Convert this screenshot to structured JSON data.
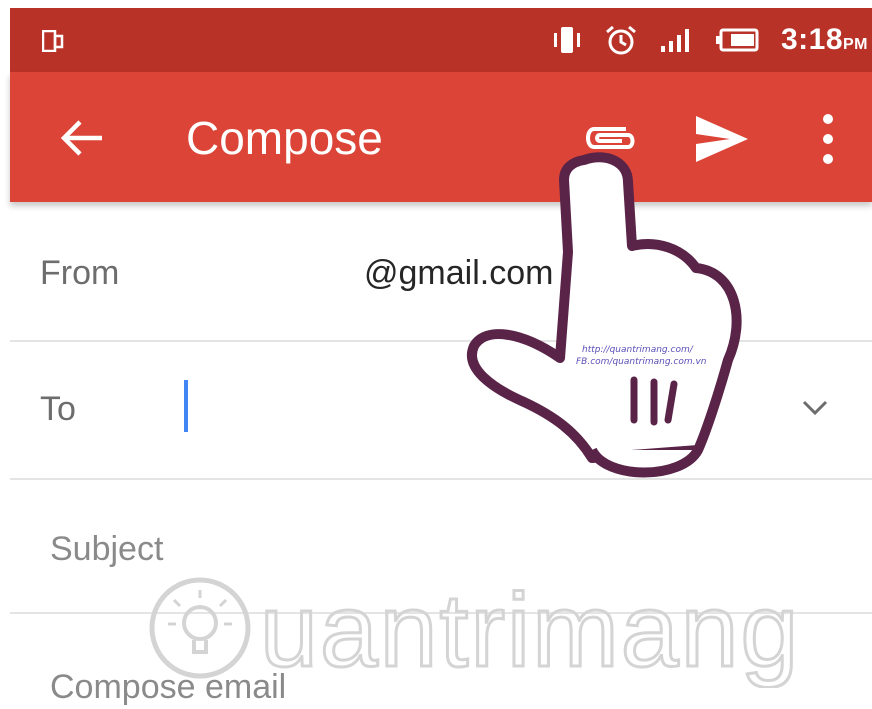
{
  "status_bar": {
    "time": "3:18",
    "ampm": "PM",
    "icons": [
      "sim-icon",
      "vibrate-icon",
      "alarm-icon",
      "signal-icon",
      "battery-icon"
    ],
    "background_color": "#b93228"
  },
  "app_bar": {
    "title": "Compose",
    "background_color": "#db4437",
    "icons": [
      "back-arrow-icon",
      "attach-icon",
      "send-icon",
      "more-vert-icon"
    ]
  },
  "form": {
    "from_label": "From",
    "from_value": "@gmail.com",
    "to_label": "To",
    "to_value": "",
    "subject_placeholder": "Subject",
    "body_placeholder": "Compose email",
    "cursor_color": "#4285f4"
  },
  "watermark": {
    "brand": "Quantrimang",
    "hand_text_line1": "http://quantrimang.com/",
    "hand_text_line2": "FB.com/quantrimang.com.vn"
  }
}
